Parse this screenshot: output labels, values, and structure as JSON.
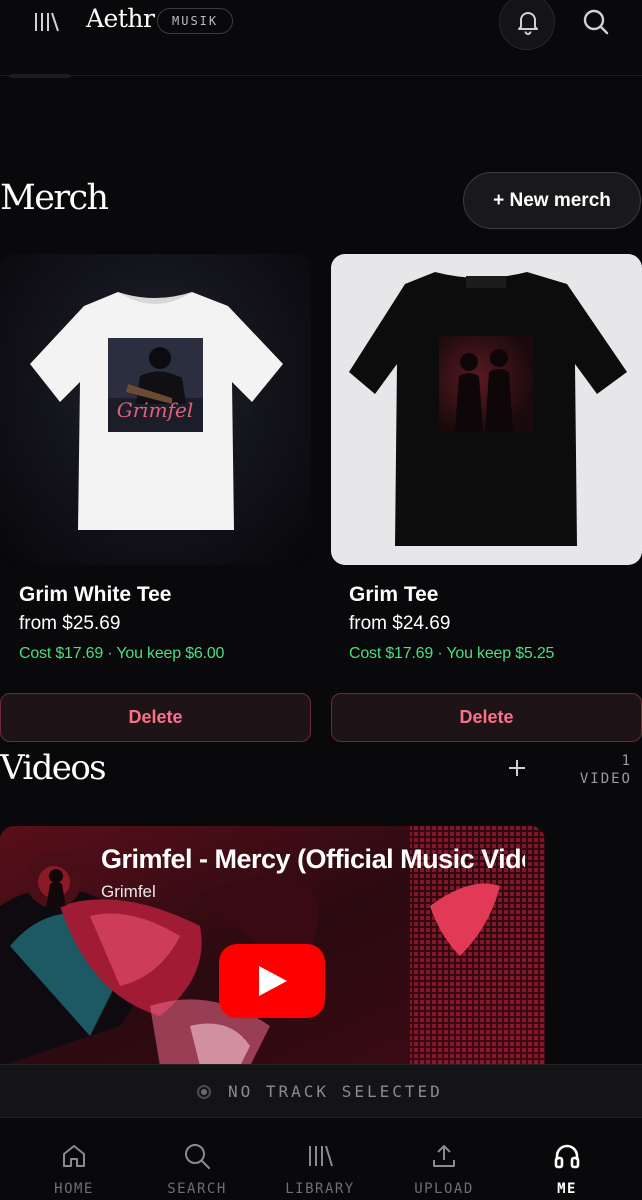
{
  "header": {
    "app_title": "Aethr",
    "badge": "MUSIK",
    "icons": [
      "library-icon",
      "bell-icon",
      "search-icon"
    ]
  },
  "merch": {
    "heading": "Merch",
    "new_button": "+ New merch",
    "items": [
      {
        "title": "Grim White Tee",
        "price": "from $25.69",
        "cost": "Cost $17.69 · You keep $6.00",
        "delete": "Delete",
        "shirt_color": "white"
      },
      {
        "title": "Grim Tee",
        "price": "from $24.69",
        "cost": "Cost $17.69 · You keep $5.25",
        "delete": "Delete",
        "shirt_color": "black"
      }
    ],
    "print_text": "Grimfel"
  },
  "videos": {
    "heading": "Videos",
    "count_number": "1",
    "count_label": "VIDEO",
    "items": [
      {
        "title": "Grimfel - Mercy (Official Music Video)",
        "channel": "Grimfel"
      }
    ]
  },
  "player": {
    "status": "NO TRACK SELECTED"
  },
  "nav": {
    "items": [
      {
        "label": "HOME",
        "icon": "home-icon"
      },
      {
        "label": "SEARCH",
        "icon": "search-icon"
      },
      {
        "label": "LIBRARY",
        "icon": "library-icon"
      },
      {
        "label": "UPLOAD",
        "icon": "upload-icon"
      },
      {
        "label": "ME",
        "icon": "headphones-icon",
        "active": true
      }
    ]
  },
  "colors": {
    "background": "#09090b",
    "accent_green": "#4ade80",
    "delete_red": "#f87188",
    "youtube_red": "#ff0000"
  }
}
